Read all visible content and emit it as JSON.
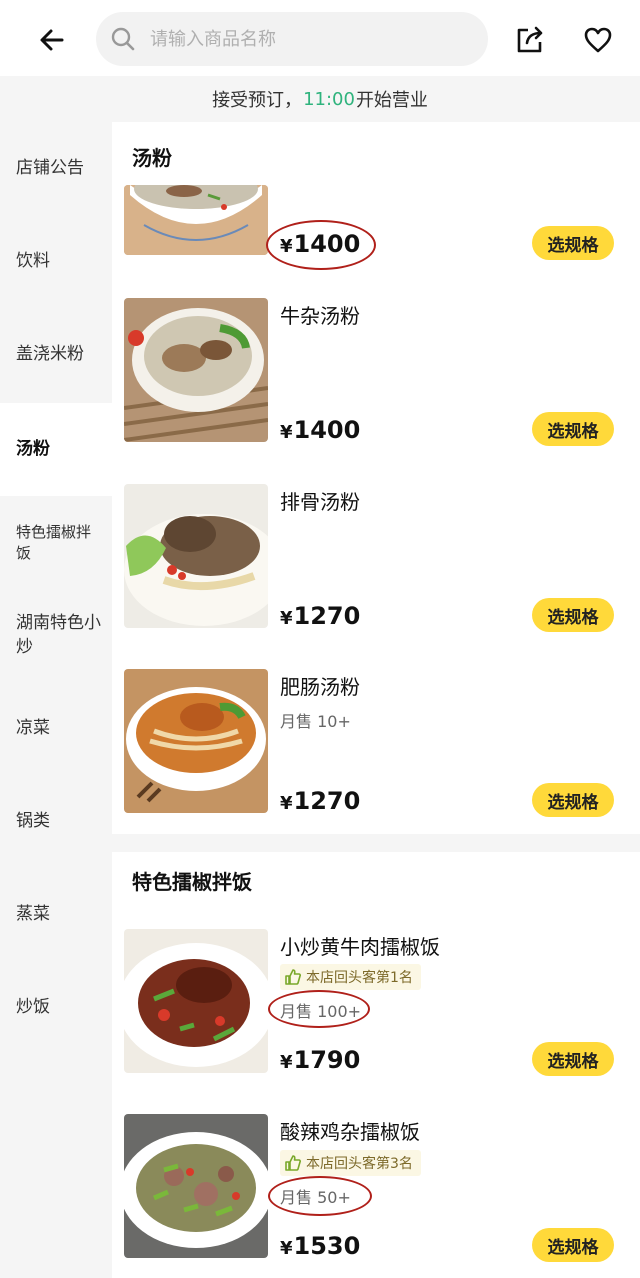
{
  "header": {
    "search_placeholder": "请输入商品名称"
  },
  "notice": {
    "prefix": "接受预订，",
    "time": "11:00",
    "suffix": "开始营业"
  },
  "sidebar": {
    "items": [
      {
        "label": "店铺公告"
      },
      {
        "label": "饮料"
      },
      {
        "label": "盖浇米粉"
      },
      {
        "label": "汤粉"
      },
      {
        "label": "特色擂椒拌饭"
      },
      {
        "label": "湖南特色小炒"
      },
      {
        "label": "凉菜"
      },
      {
        "label": "锅类"
      },
      {
        "label": "蒸菜"
      },
      {
        "label": "炒饭"
      }
    ],
    "active_index": 3
  },
  "sections": [
    {
      "title": "汤粉",
      "items": [
        {
          "name": "",
          "price": "1400",
          "currency": "¥",
          "button": "选规格"
        },
        {
          "name": "牛杂汤粉",
          "price": "1400",
          "currency": "¥",
          "button": "选规格"
        },
        {
          "name": "排骨汤粉",
          "price": "1270",
          "currency": "¥",
          "button": "选规格"
        },
        {
          "name": "肥肠汤粉",
          "sales": "月售 10+",
          "price": "1270",
          "currency": "¥",
          "button": "选规格"
        }
      ]
    },
    {
      "title": "特色擂椒拌饭",
      "items": [
        {
          "name": "小炒黄牛肉擂椒饭",
          "badge": "本店回头客第1名",
          "sales": "月售 100+",
          "price": "1790",
          "currency": "¥",
          "button": "选规格"
        },
        {
          "name": "酸辣鸡杂擂椒饭",
          "badge": "本店回头客第3名",
          "sales": "月售 50+",
          "price": "1530",
          "currency": "¥",
          "button": "选规格"
        }
      ]
    }
  ],
  "colors": {
    "accent_button": "#ffd93a",
    "time_highlight": "#2fb37d",
    "annotation_circle": "#b0201a"
  }
}
